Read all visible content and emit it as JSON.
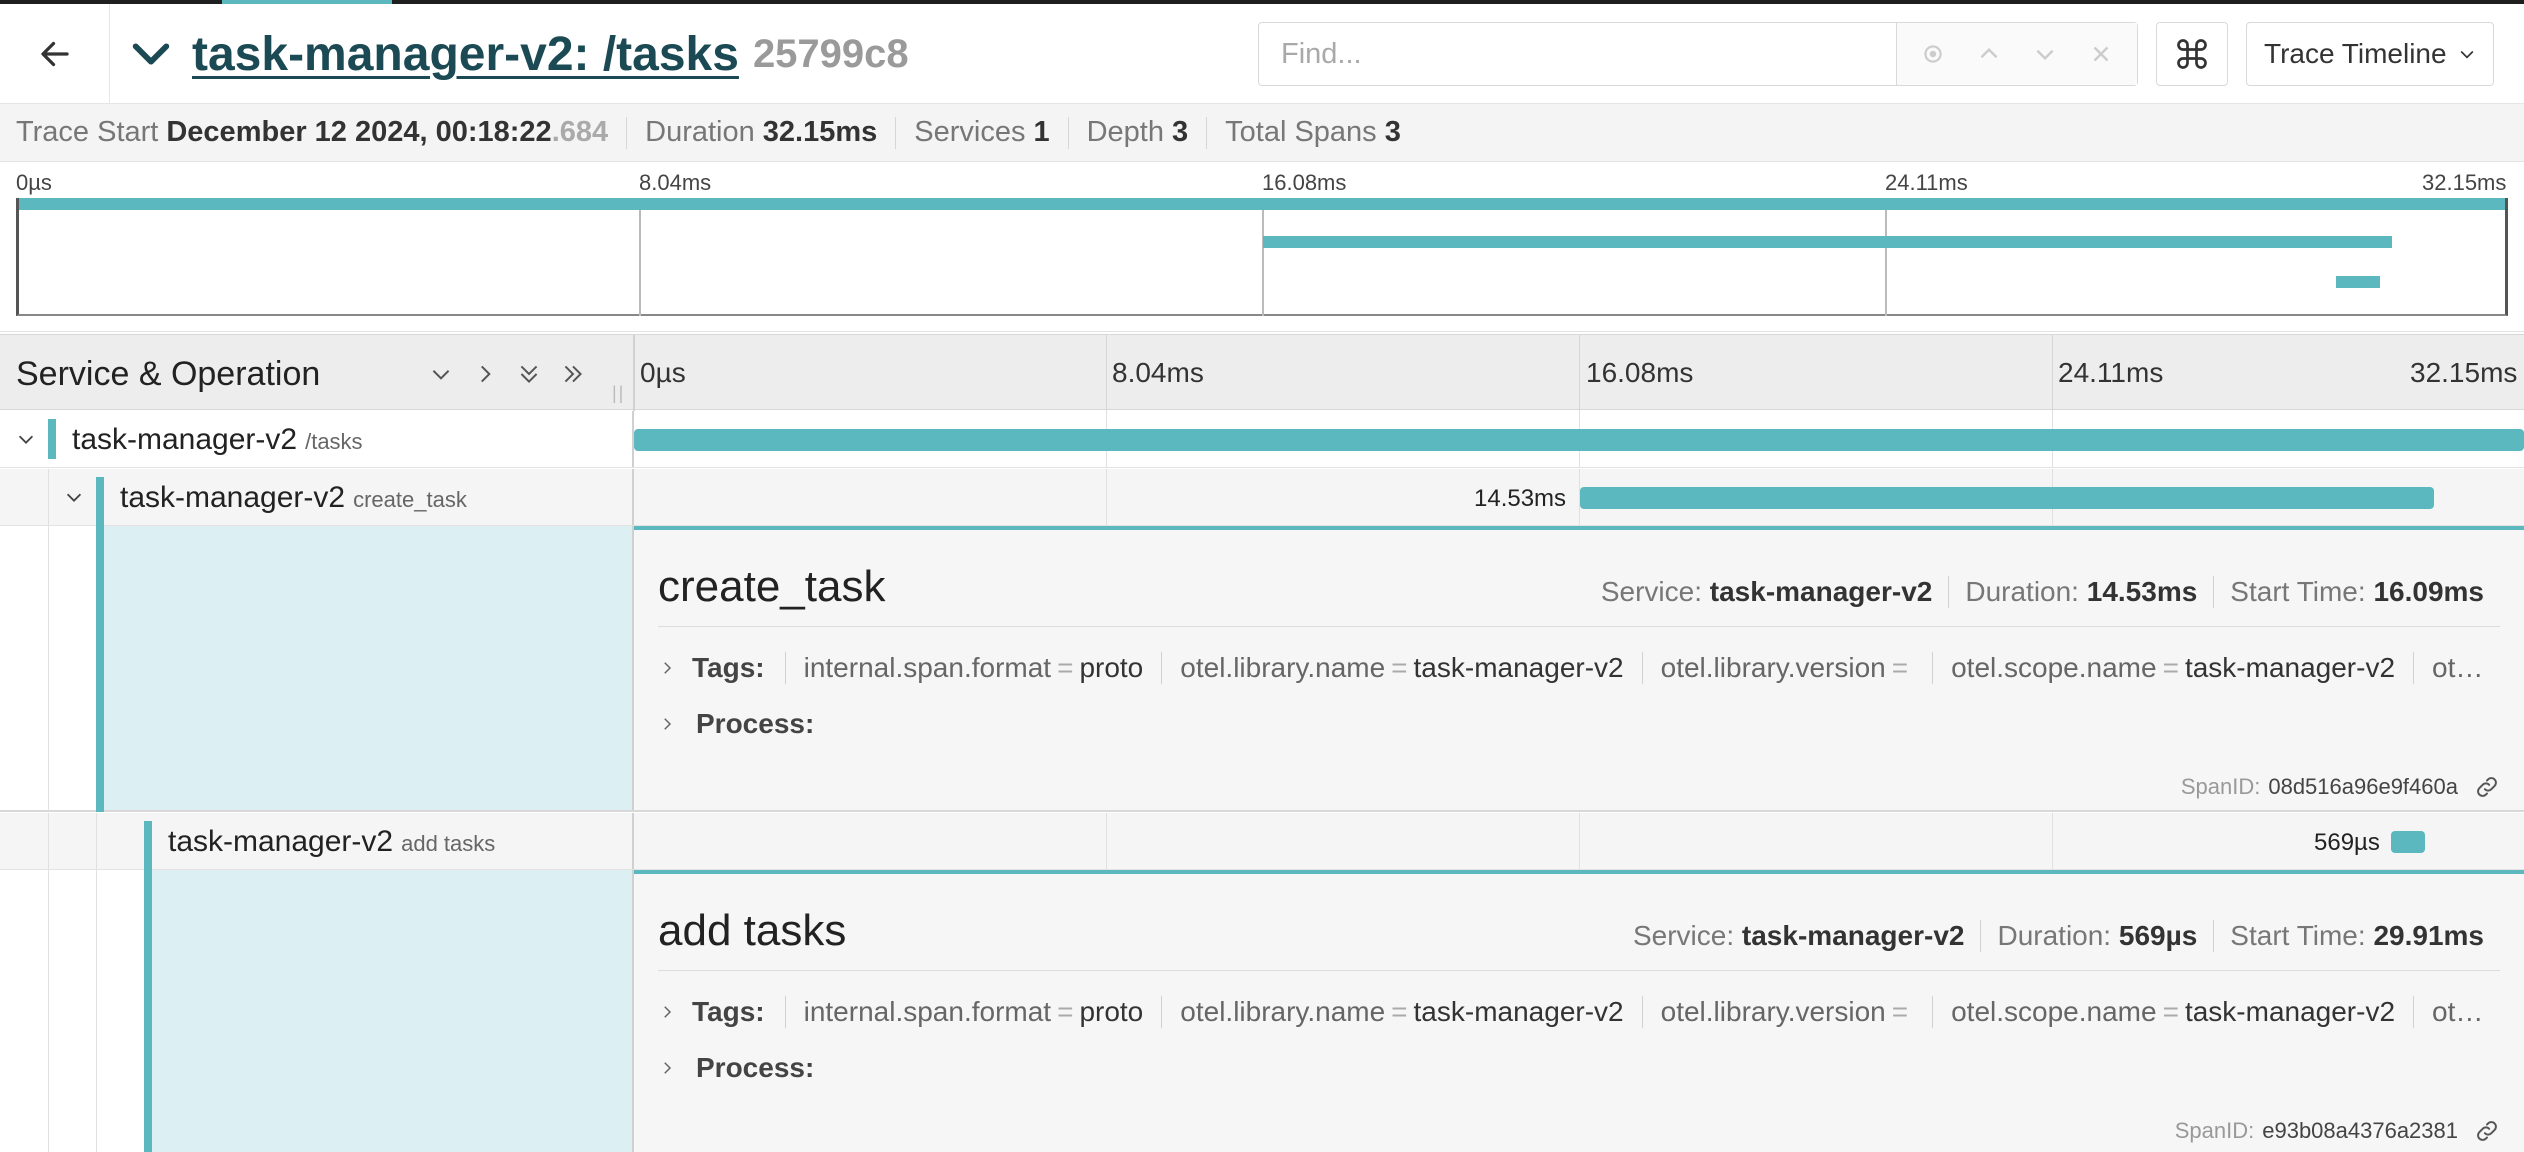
{
  "header": {
    "title": "task-manager-v2: /tasks",
    "trace_id": "25799c8",
    "find_placeholder": "Find...",
    "view_select": "Trace Timeline"
  },
  "stats": {
    "trace_start_label": "Trace Start",
    "trace_start_value": "December 12 2024, 00:18:22",
    "trace_start_ms": ".684",
    "duration_label": "Duration",
    "duration_value": "32.15ms",
    "services_label": "Services",
    "services_value": "1",
    "depth_label": "Depth",
    "depth_value": "3",
    "total_spans_label": "Total Spans",
    "total_spans_value": "3"
  },
  "minimap": {
    "ticks": [
      "0µs",
      "8.04ms",
      "16.08ms",
      "24.11ms",
      "32.15ms"
    ]
  },
  "timeline": {
    "column_title": "Service & Operation",
    "ticks": [
      "0µs",
      "8.04ms",
      "16.08ms",
      "24.11ms",
      "32.15ms"
    ]
  },
  "spans": [
    {
      "service": "task-manager-v2",
      "operation": "/tasks",
      "duration_label": ""
    },
    {
      "service": "task-manager-v2",
      "operation": "create_task",
      "duration_label": "14.53ms"
    },
    {
      "service": "task-manager-v2",
      "operation": "add tasks",
      "duration_label": "569µs"
    }
  ],
  "details": [
    {
      "title": "create_task",
      "service_label": "Service:",
      "service": "task-manager-v2",
      "duration_label": "Duration:",
      "duration": "14.53ms",
      "start_label": "Start Time:",
      "start": "16.09ms",
      "tags_label": "Tags:",
      "tags": [
        {
          "k": "internal.span.format",
          "v": "proto"
        },
        {
          "k": "otel.library.name",
          "v": "task-manager-v2"
        },
        {
          "k": "otel.library.version",
          "v": ""
        },
        {
          "k": "otel.scope.name",
          "v": "task-manager-v2"
        },
        {
          "k": "ot…",
          "v": ""
        }
      ],
      "process_label": "Process:",
      "span_id_label": "SpanID:",
      "span_id": "08d516a96e9f460a"
    },
    {
      "title": "add tasks",
      "service_label": "Service:",
      "service": "task-manager-v2",
      "duration_label": "Duration:",
      "duration": "569µs",
      "start_label": "Start Time:",
      "start": "29.91ms",
      "tags_label": "Tags:",
      "tags": [
        {
          "k": "internal.span.format",
          "v": "proto"
        },
        {
          "k": "otel.library.name",
          "v": "task-manager-v2"
        },
        {
          "k": "otel.library.version",
          "v": ""
        },
        {
          "k": "otel.scope.name",
          "v": "task-manager-v2"
        },
        {
          "k": "ot…",
          "v": ""
        }
      ],
      "process_label": "Process:",
      "span_id_label": "SpanID:",
      "span_id": "e93b08a4376a2381"
    }
  ],
  "colors": {
    "accent": "#5bb8bf",
    "title": "#1b4a55"
  }
}
